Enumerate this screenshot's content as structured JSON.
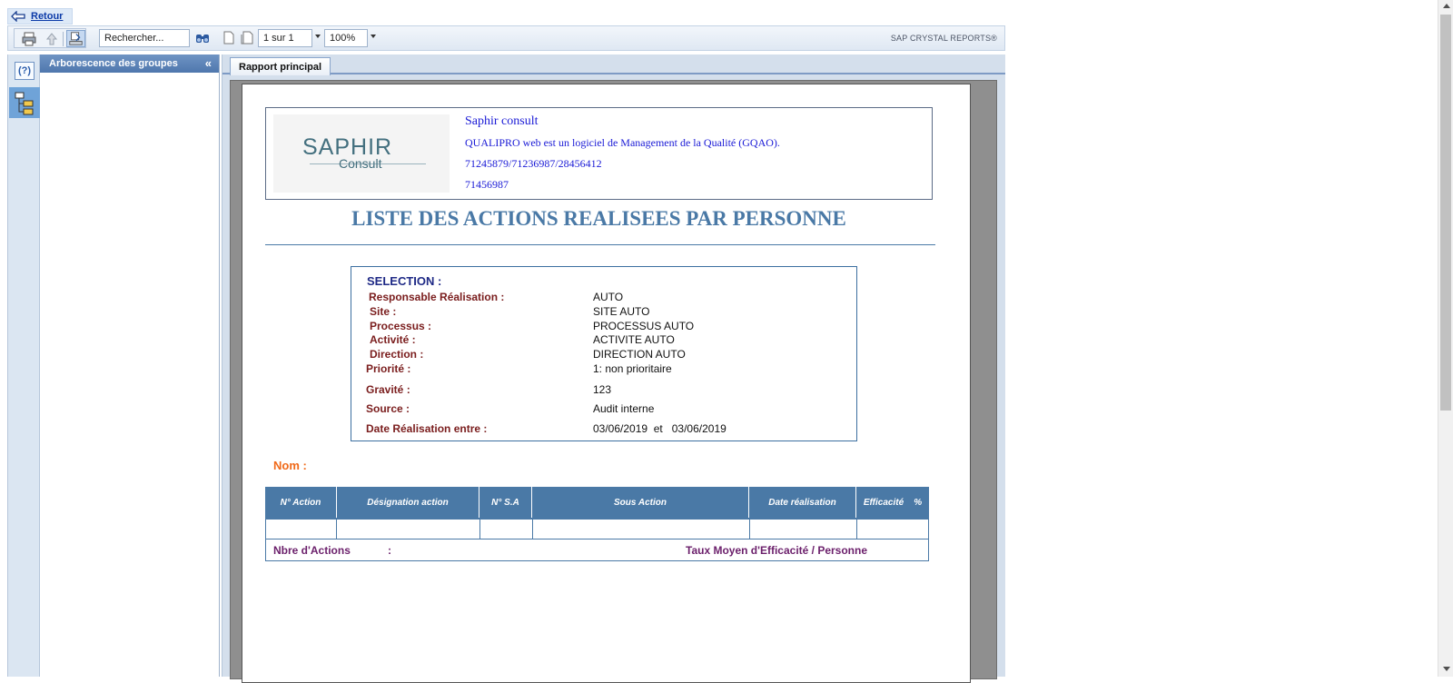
{
  "top": {
    "back_label": "Retour"
  },
  "toolbar": {
    "search_placeholder": "Rechercher...",
    "page_value": "1 sur 1",
    "zoom_value": "100%",
    "brand": "SAP CRYSTAL REPORTS®"
  },
  "left_panel": {
    "title": "Arborescence des groupes",
    "help_label": "(?)"
  },
  "tabs": [
    {
      "label": "Rapport principal"
    }
  ],
  "report": {
    "company": {
      "logo_text_1": "SAPHIR",
      "logo_text_2": "Consult",
      "name": "Saphir consult",
      "line2": "QUALIPRO web est un logiciel de Management de la Qualité (GQAO).",
      "line3": "71245879/71236987/28456412",
      "line4": "71456987"
    },
    "title": "LISTE DES ACTIONS REALISEES PAR PERSONNE",
    "selection": {
      "heading": "SELECTION :",
      "rows": [
        {
          "label": "Responsable Réalisation :",
          "value": "AUTO"
        },
        {
          "label": "Site :",
          "value": "SITE AUTO"
        },
        {
          "label": "Processus :",
          "value": "PROCESSUS AUTO"
        },
        {
          "label": "Activité :",
          "value": "ACTIVITE AUTO"
        },
        {
          "label": "Direction :",
          "value": "DIRECTION AUTO"
        },
        {
          "label": "Priorité :",
          "value": "1: non prioritaire"
        },
        {
          "label": "Gravité :",
          "value": "123"
        },
        {
          "label": "Source :",
          "value": "Audit interne"
        },
        {
          "label": "Date Réalisation entre :",
          "value": "03/06/2019  et   03/06/2019"
        }
      ]
    },
    "nom_label": "Nom :",
    "columns": [
      "N° Action",
      "Désignation action",
      "N° S.A",
      "Sous Action",
      "Date réalisation",
      "Efficacité    %"
    ],
    "footer": {
      "count_label": "Nbre d'Actions",
      "colon": ":",
      "avg_label": "Taux Moyen d'Efficacité / Personne"
    }
  }
}
